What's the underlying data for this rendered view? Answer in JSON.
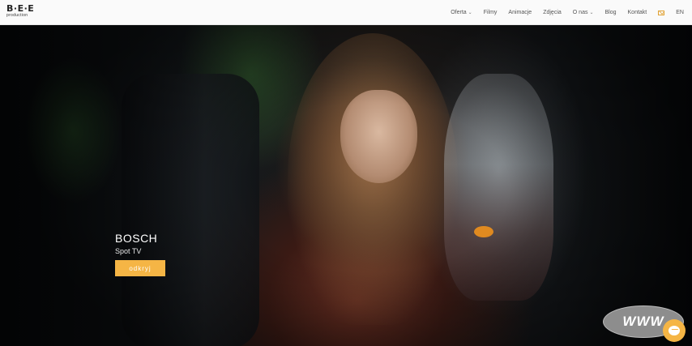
{
  "brand": {
    "mark": "B·E·E",
    "sub": "production"
  },
  "nav": {
    "items": [
      {
        "label": "Oferta",
        "dropdown": true
      },
      {
        "label": "Filmy",
        "dropdown": false
      },
      {
        "label": "Animacje",
        "dropdown": false
      },
      {
        "label": "Zdjęcia",
        "dropdown": false
      },
      {
        "label": "O nas",
        "dropdown": true
      },
      {
        "label": "Blog",
        "dropdown": false
      },
      {
        "label": "Kontakt",
        "dropdown": false
      }
    ],
    "language": "EN",
    "mail_icon": "envelope-icon"
  },
  "hero": {
    "title": "BOSCH",
    "subtitle": "Spot TV",
    "button_label": "odkryj"
  },
  "badge": {
    "text": "WWW"
  },
  "colors": {
    "accent": "#f5b545",
    "nav_bg": "#fafafa",
    "nav_text": "#555555"
  }
}
